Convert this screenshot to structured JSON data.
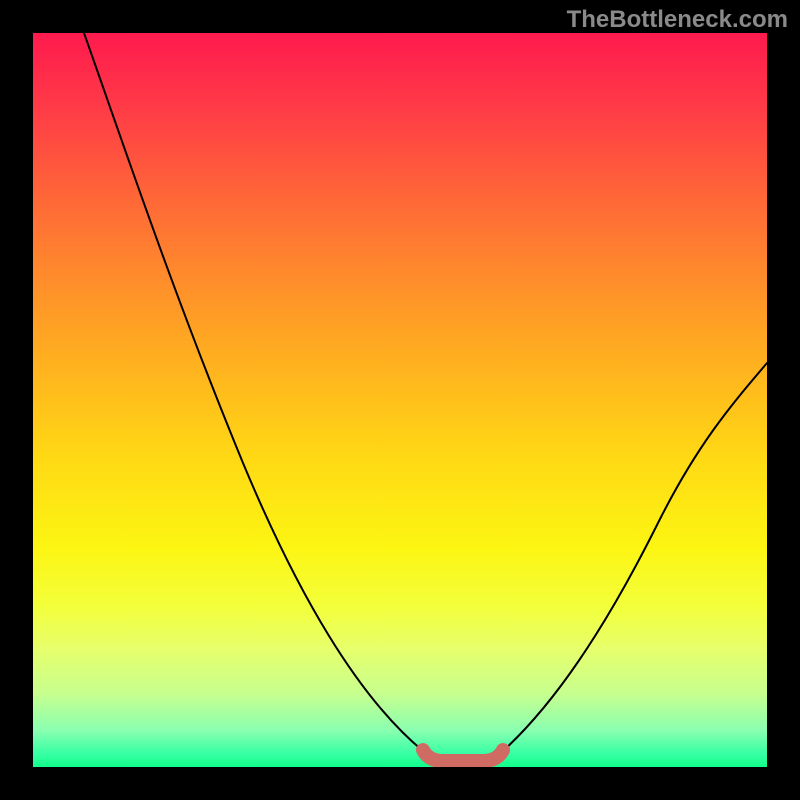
{
  "watermark": "TheBottleneck.com",
  "colors": {
    "frame": "#000000",
    "curve": "#000000",
    "uSegment": "#cf6b62"
  },
  "chart_data": {
    "type": "line",
    "title": "",
    "xlabel": "",
    "ylabel": "",
    "xlim": [
      0,
      100
    ],
    "ylim": [
      0,
      100
    ],
    "grid": false,
    "legend": false,
    "series": [
      {
        "name": "left-curve",
        "x": [
          7,
          15,
          25,
          35,
          47,
          53
        ],
        "y": [
          100,
          82,
          57,
          34,
          9,
          2
        ]
      },
      {
        "name": "right-curve",
        "x": [
          64,
          70,
          80,
          90,
          100
        ],
        "y": [
          2,
          8,
          22,
          38,
          55
        ]
      },
      {
        "name": "bottom-u-highlight",
        "x": [
          53,
          55,
          62,
          64
        ],
        "y": [
          2,
          0.5,
          0.5,
          2
        ]
      }
    ],
    "note": "Values are visual estimates from the plot. Curves form a V shape with a short U-shaped highlighted segment at the bottom between x≈53 and x≈64."
  }
}
